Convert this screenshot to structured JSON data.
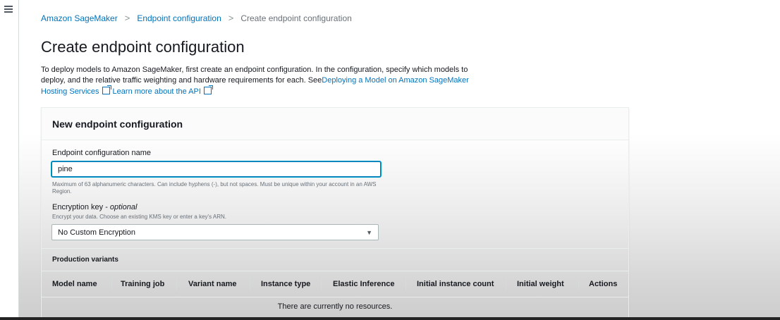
{
  "breadcrumb": {
    "root": "Amazon SageMaker",
    "parent": "Endpoint configuration",
    "current": "Create endpoint configuration",
    "separator": ">"
  },
  "page": {
    "title": "Create endpoint configuration",
    "intro_text": "To deploy models to Amazon SageMaker, first create an endpoint configuration. In the configuration, specify which models to deploy, and the relative traffic weighting and hardware requirements for each. See",
    "intro_link_hosting": "Deploying a Model on Amazon SageMaker Hosting Services",
    "intro_link_api": "Learn more about the API"
  },
  "form": {
    "section_title": "New endpoint configuration",
    "name_label": "Endpoint configuration name",
    "name_value": "pine",
    "name_hint": "Maximum of 63 alphanumeric characters. Can include hyphens (-), but not spaces. Must be unique within your account in an AWS Region.",
    "encryption_label": "Encryption key - ",
    "encryption_optional": "optional",
    "encryption_hint": "Encrypt your data. Choose an existing KMS key or enter a key's ARN.",
    "encryption_selected": "No Custom Encryption"
  },
  "variants": {
    "title": "Production variants",
    "columns": [
      "Model name",
      "Training job",
      "Variant name",
      "Instance type",
      "Elastic Inference",
      "Initial instance count",
      "Initial weight",
      "Actions"
    ],
    "empty_message": "There are currently no resources."
  },
  "icons": {
    "menu": "hamburger-menu-icon",
    "external": "external-link-icon",
    "dropdown": "caret-down-icon"
  },
  "colors": {
    "link": "#0073bb",
    "focus": "#00a1c9",
    "text": "#16191f"
  }
}
